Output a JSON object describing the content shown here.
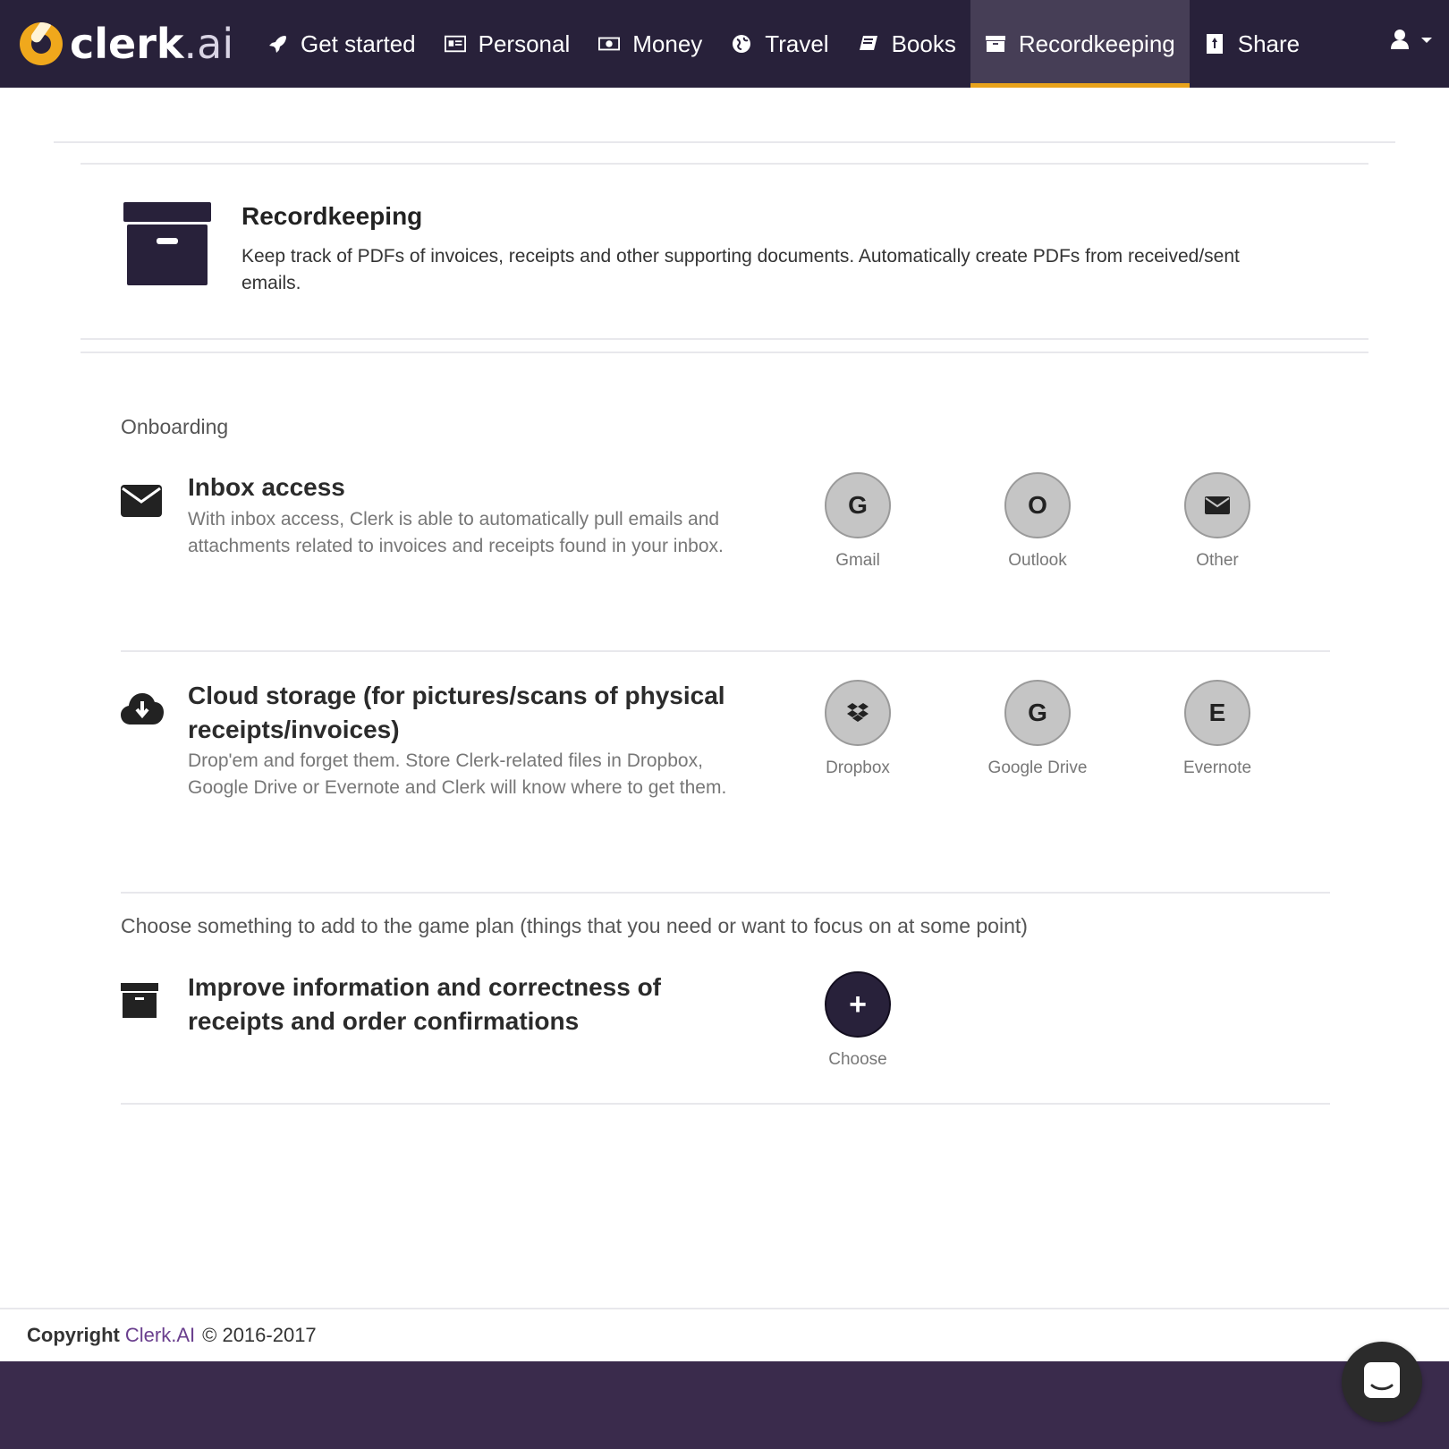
{
  "brand": {
    "name_main": "clerk",
    "name_suffix": ".ai"
  },
  "nav": {
    "items": [
      {
        "label": "Get started",
        "icon": "rocket-icon"
      },
      {
        "label": "Personal",
        "icon": "id-card-icon"
      },
      {
        "label": "Money",
        "icon": "money-icon"
      },
      {
        "label": "Travel",
        "icon": "globe-icon"
      },
      {
        "label": "Books",
        "icon": "book-icon"
      },
      {
        "label": "Recordkeeping",
        "icon": "archive-icon",
        "active": true
      },
      {
        "label": "Share",
        "icon": "share-icon"
      }
    ],
    "user_icon": "user-icon"
  },
  "hero": {
    "title": "Recordkeeping",
    "description": "Keep track of PDFs of invoices, receipts and other supporting documents. Automatically create PDFs from received/sent emails."
  },
  "onboarding": {
    "title": "Onboarding",
    "inbox": {
      "title": "Inbox access",
      "description": "With inbox access, Clerk is able to automatically pull emails and attachments related to invoices and receipts found in your inbox.",
      "providers": [
        {
          "glyph": "G",
          "label": "Gmail"
        },
        {
          "glyph": "O",
          "label": "Outlook"
        },
        {
          "glyph": "envelope",
          "label": "Other"
        }
      ]
    },
    "cloud": {
      "title": "Cloud storage (for pictures/scans of physical receipts/invoices)",
      "description": "Drop'em and forget them. Store Clerk-related files in Dropbox, Google Drive or Evernote and Clerk will know where to get them.",
      "providers": [
        {
          "glyph": "dropbox",
          "label": "Dropbox"
        },
        {
          "glyph": "G",
          "label": "Google Drive"
        },
        {
          "glyph": "E",
          "label": "Evernote"
        }
      ]
    }
  },
  "game_plan": {
    "title": "Choose something to add to the game plan (things that you need or want to focus on at some point)",
    "item": {
      "title": "Improve information and correctness of receipts and order confirmations",
      "action_glyph": "+",
      "action_label": "Choose"
    }
  },
  "footer": {
    "copyright_label": "Copyright",
    "brand_link": "Clerk.AI",
    "years": "© 2016-2017"
  },
  "colors": {
    "nav_bg": "#28213a",
    "accent": "#e8a31b",
    "footer_band": "#3a2b4c"
  }
}
